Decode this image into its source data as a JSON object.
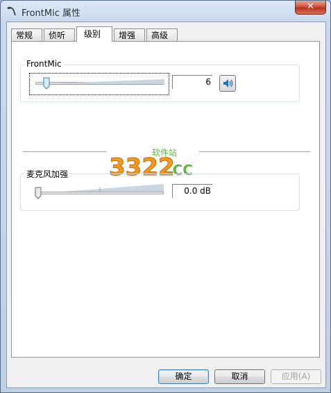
{
  "window": {
    "title": "FrontMic 属性",
    "close_label": "✕"
  },
  "tabs": [
    {
      "label": "常规",
      "active": false
    },
    {
      "label": "侦听",
      "active": false
    },
    {
      "label": "级别",
      "active": true
    },
    {
      "label": "增强",
      "active": false
    },
    {
      "label": "高级",
      "active": false
    }
  ],
  "frontmic_group": {
    "title": "FrontMic",
    "level_value": "6",
    "level_fraction": 0.06
  },
  "boost_group": {
    "title": "麦克风加强",
    "value": "0.0 dB",
    "level_fraction": 0.0
  },
  "watermark": {
    "brand": "3322",
    "suffix": ".CC",
    "tagline": "软件站"
  },
  "buttons": {
    "ok": "确定",
    "cancel": "取消",
    "apply": "应用(A)"
  },
  "colors": {
    "accent": "#3c7fb1",
    "speaker": "#1f6fd0",
    "watermark_orange": "#f39a1e",
    "watermark_green": "#5bb83a"
  }
}
